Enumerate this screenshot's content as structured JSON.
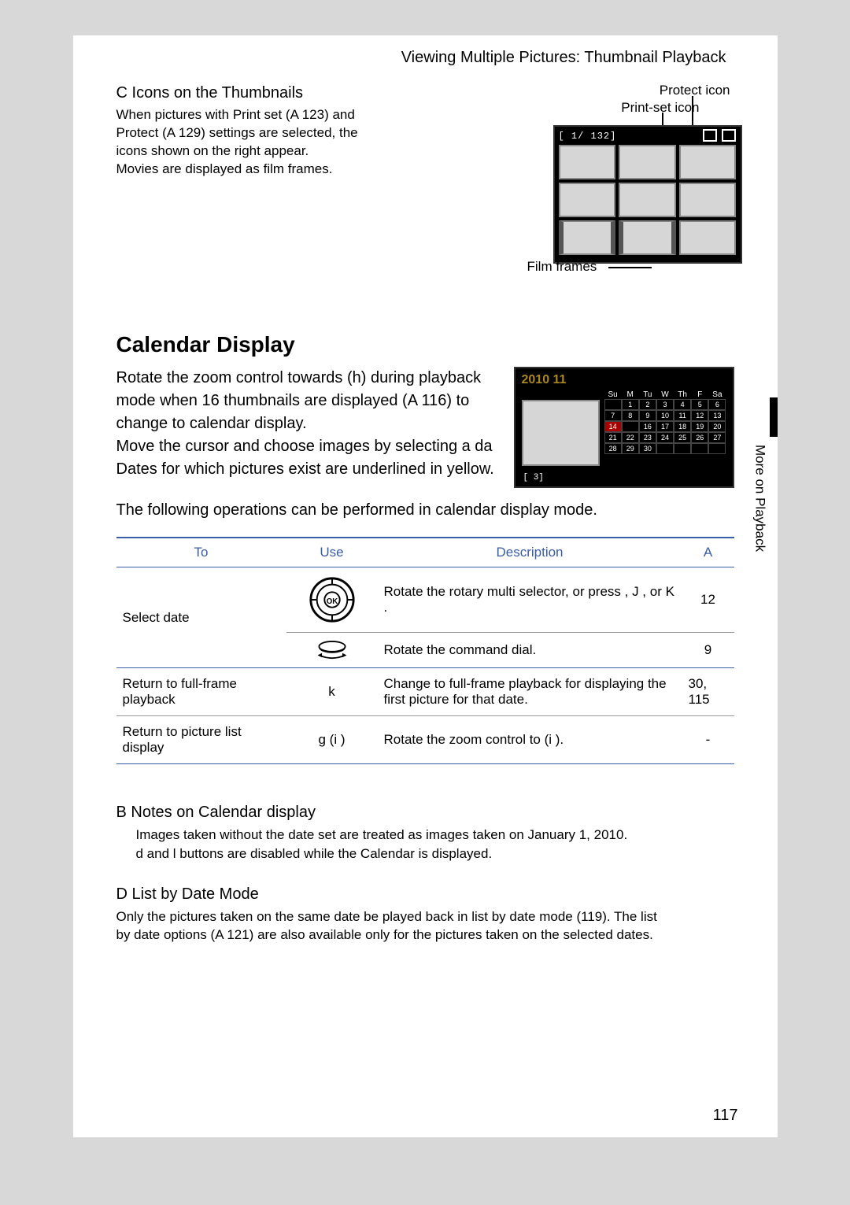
{
  "header_title": "Viewing Multiple Pictures: Thumbnail Playback",
  "section_c": {
    "lead": "C",
    "heading": "Icons on the Thumbnails",
    "body_l1": "When pictures with Print set (A 123) and",
    "body_l2": "Protect (A 129) settings are selected, the",
    "body_l3": "icons shown on the right appear.",
    "body_l4": "Movies are displayed as film frames."
  },
  "thumb": {
    "label_protect": "Protect icon",
    "label_printset": "Print-set icon",
    "label_film": "Film frames",
    "counter": "[   1/ 132]"
  },
  "calendar": {
    "heading": "Calendar Display",
    "para": "Rotate the zoom control towards (h) during playback mode when 16 thumbnails are displayed (A 116) to change to calendar display.\nMove the cursor and choose images by selecting a da\nDates for which pictures exist are underlined in yellow.",
    "ops_intro": "The following operations can be performed in calendar display mode.",
    "lcd": {
      "year": "2010   11",
      "days": "Su M Tu W Th F Sa",
      "rows": [
        [
          "",
          "",
          "1",
          "2",
          "3",
          "4",
          "5",
          "6"
        ],
        [
          "7",
          "8",
          "9",
          "10",
          "11",
          "12",
          "13"
        ],
        [
          "14",
          "",
          "16",
          "17",
          "18",
          "19",
          "20"
        ],
        [
          "21",
          "22",
          "23",
          "24",
          "25",
          "26",
          "27"
        ],
        [
          "28",
          "29",
          "30",
          "",
          "",
          "",
          ""
        ]
      ],
      "count": "[  3]"
    }
  },
  "table": {
    "hdr_to": "To",
    "hdr_use": "Use",
    "hdr_desc": "Description",
    "hdr_ref": "A",
    "r1_to": "Select date",
    "r1_desc": "Rotate the rotary multi selector, or press , J , or K .",
    "r1_ref": "12",
    "r1b_desc": "Rotate the command dial.",
    "r1b_ref": "9",
    "r2_to": "Return to full-frame playback",
    "r2_use": "k",
    "r2_desc": "Change to full-frame playback for displaying the first picture for that date.",
    "r2_ref": "30, 115",
    "r3_to": "Return to picture list display",
    "r3_use": "g (i )",
    "r3_desc": "Rotate the zoom control to (i ).",
    "r3_ref": "-"
  },
  "note_b": {
    "lead": "B",
    "heading": "Notes on Calendar display",
    "line1": "Images taken without the date set are treated as images taken on January 1, 2010.",
    "line2": "d   and l   buttons are disabled while the Calendar is displayed."
  },
  "note_d": {
    "lead": "D",
    "heading": "List by Date Mode",
    "line1": "Only the pictures taken on the same date be played back in list by date mode (119). The list",
    "line2": "by date options (A 121) are also available only for the pictures taken on the selected dates."
  },
  "side_tab": "More on Playback",
  "page_number": "117"
}
